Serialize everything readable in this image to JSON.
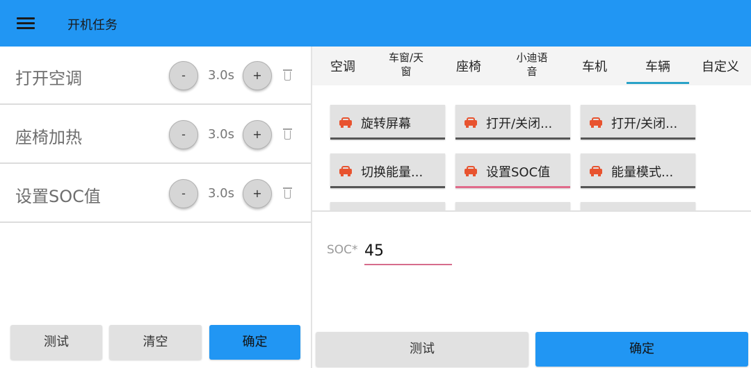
{
  "appbar": {
    "title": "开机任务",
    "menu_icon": "menu-icon"
  },
  "tasks": [
    {
      "label": "打开空调",
      "duration": "3.0s",
      "minus": "-",
      "plus": "+"
    },
    {
      "label": "座椅加热",
      "duration": "3.0s",
      "minus": "-",
      "plus": "+"
    },
    {
      "label": "设置SOC值",
      "duration": "3.0s",
      "minus": "-",
      "plus": "+"
    }
  ],
  "left_actions": {
    "test": "测试",
    "clear": "清空",
    "confirm": "确定"
  },
  "tabs": [
    {
      "label": "空调"
    },
    {
      "label": "车窗/天窗",
      "line1": "车窗/天",
      "line2": "窗"
    },
    {
      "label": "座椅"
    },
    {
      "label": "小迪语音",
      "line1": "小迪语",
      "line2": "音"
    },
    {
      "label": "车机"
    },
    {
      "label": "车辆",
      "selected": true
    },
    {
      "label": "自定义"
    }
  ],
  "action_chips": [
    {
      "label": "旋转屏幕",
      "icon": "car-icon"
    },
    {
      "label": "打开/关闭...",
      "icon": "car-icon"
    },
    {
      "label": "打开/关闭...",
      "icon": "car-icon"
    },
    {
      "label": "切换能量...",
      "icon": "car-icon"
    },
    {
      "label": "设置SOC值",
      "icon": "car-icon",
      "selected": true
    },
    {
      "label": "能量模式...",
      "icon": "car-icon"
    }
  ],
  "soc_field": {
    "label": "SOC*",
    "value": "45"
  },
  "right_actions": {
    "test": "测试",
    "confirm": "确定"
  },
  "colors": {
    "appbar": "#2196f3",
    "primary_button": "#2196f3",
    "chip_icon": "#e8532f",
    "active_underline": "#e06a8a",
    "tab_indicator": "#2aa2c8"
  }
}
